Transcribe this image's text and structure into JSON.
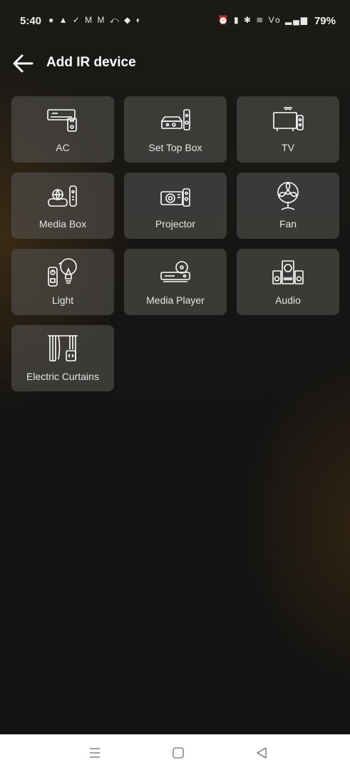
{
  "status_bar": {
    "time": "5:40",
    "left_icons": [
      "chat-bubble-icon",
      "drive-icon",
      "check-icon",
      "gmail-icon",
      "gmail-icon",
      "missed-call-icon",
      "shield-icon",
      "vpn-icon"
    ],
    "left_glyphs": "● ▲ ✓ M M ⤺ ◆ ◐",
    "right_icons": [
      "alarm-icon",
      "vibrate-icon",
      "bluetooth-icon",
      "wifi-icon",
      "volte-icon",
      "signal-icon",
      "battery-icon"
    ],
    "right_glyphs": "⏰ ▮ ✱ ≋ Vo ▂▄▆",
    "battery": "79%"
  },
  "header": {
    "title": "Add IR device",
    "back_icon": "arrow-left-icon"
  },
  "devices": [
    {
      "label": "AC",
      "icon": "air-conditioner-icon"
    },
    {
      "label": "Set Top Box",
      "icon": "set-top-box-icon"
    },
    {
      "label": "TV",
      "icon": "tv-icon"
    },
    {
      "label": "Media Box",
      "icon": "media-box-icon"
    },
    {
      "label": "Projector",
      "icon": "projector-icon"
    },
    {
      "label": "Fan",
      "icon": "fan-icon"
    },
    {
      "label": "Light",
      "icon": "light-bulb-icon"
    },
    {
      "label": "Media Player",
      "icon": "media-player-icon"
    },
    {
      "label": "Audio",
      "icon": "speaker-icon"
    },
    {
      "label": "Electric Curtains",
      "icon": "curtains-icon"
    }
  ],
  "nav": {
    "recents_icon": "menu-icon",
    "home_icon": "square-icon",
    "back_icon": "triangle-back-icon"
  },
  "colors": {
    "background": "#141414",
    "tile": "#52504e",
    "text": "#e6e6e6",
    "title": "#ffffff",
    "nav_bar": "#ffffff"
  }
}
